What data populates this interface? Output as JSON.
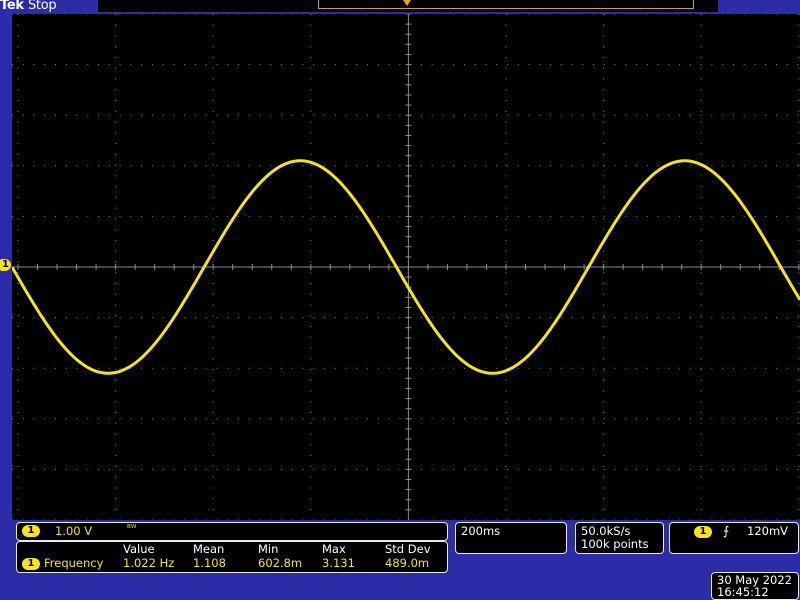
{
  "header": {
    "brand": "Tek",
    "status": "Stop"
  },
  "channel": {
    "number": "1",
    "scale": "1.00 V",
    "bandwidth_icon": "bandwidth-limit-icon"
  },
  "timebase": "200ms",
  "acquisition": {
    "sample_rate": "50.0kS/s",
    "record_length": "100k points"
  },
  "trigger": {
    "channel": "1",
    "slope_icon": "rising-edge-icon",
    "slope_glyph": "⨍",
    "level": "120mV"
  },
  "measurements": {
    "headers": [
      "Value",
      "Mean",
      "Min",
      "Max",
      "Std Dev"
    ],
    "rows": [
      {
        "channel": "1",
        "name": "Frequency",
        "value": "1.022 Hz",
        "mean": "1.108",
        "min": "602.8m",
        "max": "3.131",
        "std_dev": "489.0m"
      }
    ]
  },
  "datetime": {
    "date": "30 May 2022",
    "time": "16:45:12"
  },
  "colors": {
    "trace": "#f4e41a",
    "background": "#000000",
    "frame": "#2c2ca8",
    "graticule": "#8a8a8a"
  },
  "waveform": {
    "type": "sine",
    "cycles_on_screen": 2.05,
    "phase_at_left": "zero-crossing, falling",
    "amplitude_divisions": 2.1
  }
}
